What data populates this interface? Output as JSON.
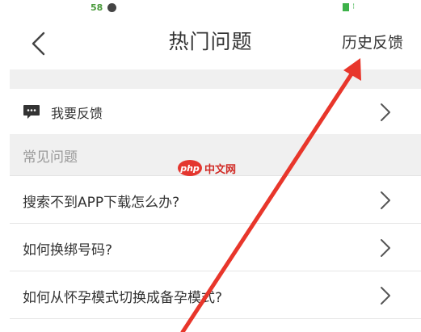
{
  "status_bar": {
    "left_text": "58"
  },
  "nav": {
    "title": "热门问题",
    "history_label": "历史反馈"
  },
  "feedback": {
    "label": "我要反馈"
  },
  "faq": {
    "section_title": "常见问题",
    "items": [
      "搜索不到APP下载怎么办?",
      "如何换绑号码?",
      "如何从怀孕模式切换成备孕模式?"
    ]
  },
  "watermark": {
    "logo": "php",
    "text": "中文网"
  },
  "colors": {
    "annotation_arrow": "#e8362b",
    "background_band": "#f0f0f0",
    "text": "#333333",
    "muted_text": "#999999"
  },
  "icons": {
    "back": "chevron-left-icon",
    "feedback": "chat-bubble-icon",
    "row_chevron": "chevron-right-icon"
  }
}
